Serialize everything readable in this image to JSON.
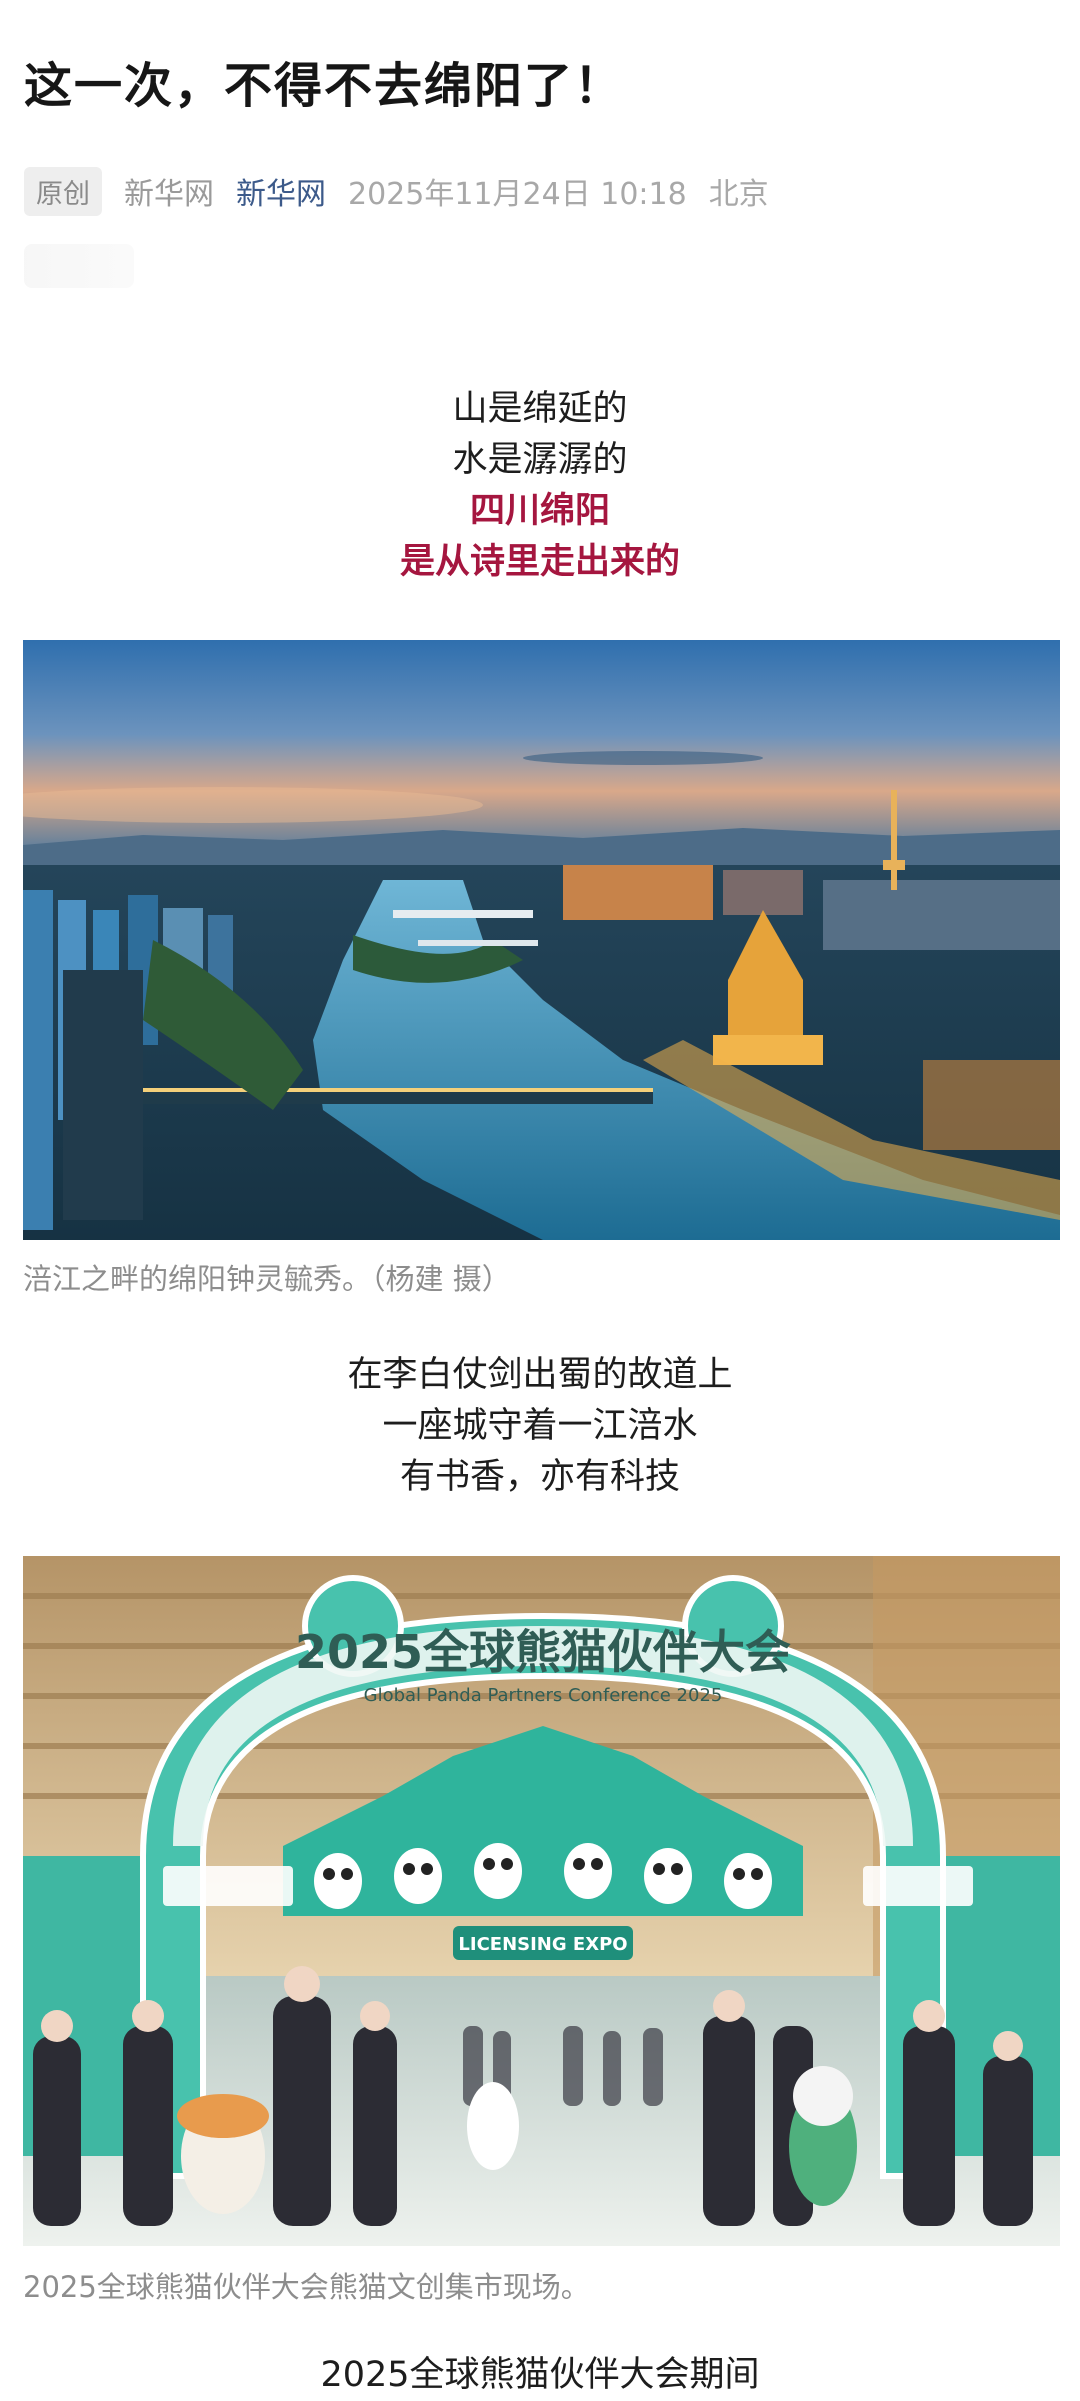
{
  "article": {
    "title": "这一次，不得不去绵阳了！",
    "meta": {
      "badge": "原创",
      "source": "新华网",
      "account": "新华网",
      "datetime": "2025年11月24日 10:18",
      "location": "北京"
    }
  },
  "poem1": {
    "line1": "山是绵延的",
    "line2": "水是潺潺的",
    "line3": "四川绵阳",
    "line4": "是从诗里走出来的",
    "highlight_color": "#a5163f"
  },
  "photo1": {
    "caption": "涪江之畔的绵阳钟灵毓秀。（杨建 摄）"
  },
  "poem2": {
    "line1": "在李白仗剑出蜀的故道上",
    "line2": "一座城守着一江涪水",
    "line3": "有书香，亦有科技"
  },
  "photo2": {
    "arch_cn": "2025全球熊猫伙伴大会",
    "arch_en": "Global Panda Partners Conference 2025",
    "banner_en": "LICENSING EXPO",
    "caption": "2025全球熊猫伙伴大会熊猫文创集市现场。"
  },
  "poem3": {
    "line1": "2025全球熊猫伙伴大会期间"
  }
}
